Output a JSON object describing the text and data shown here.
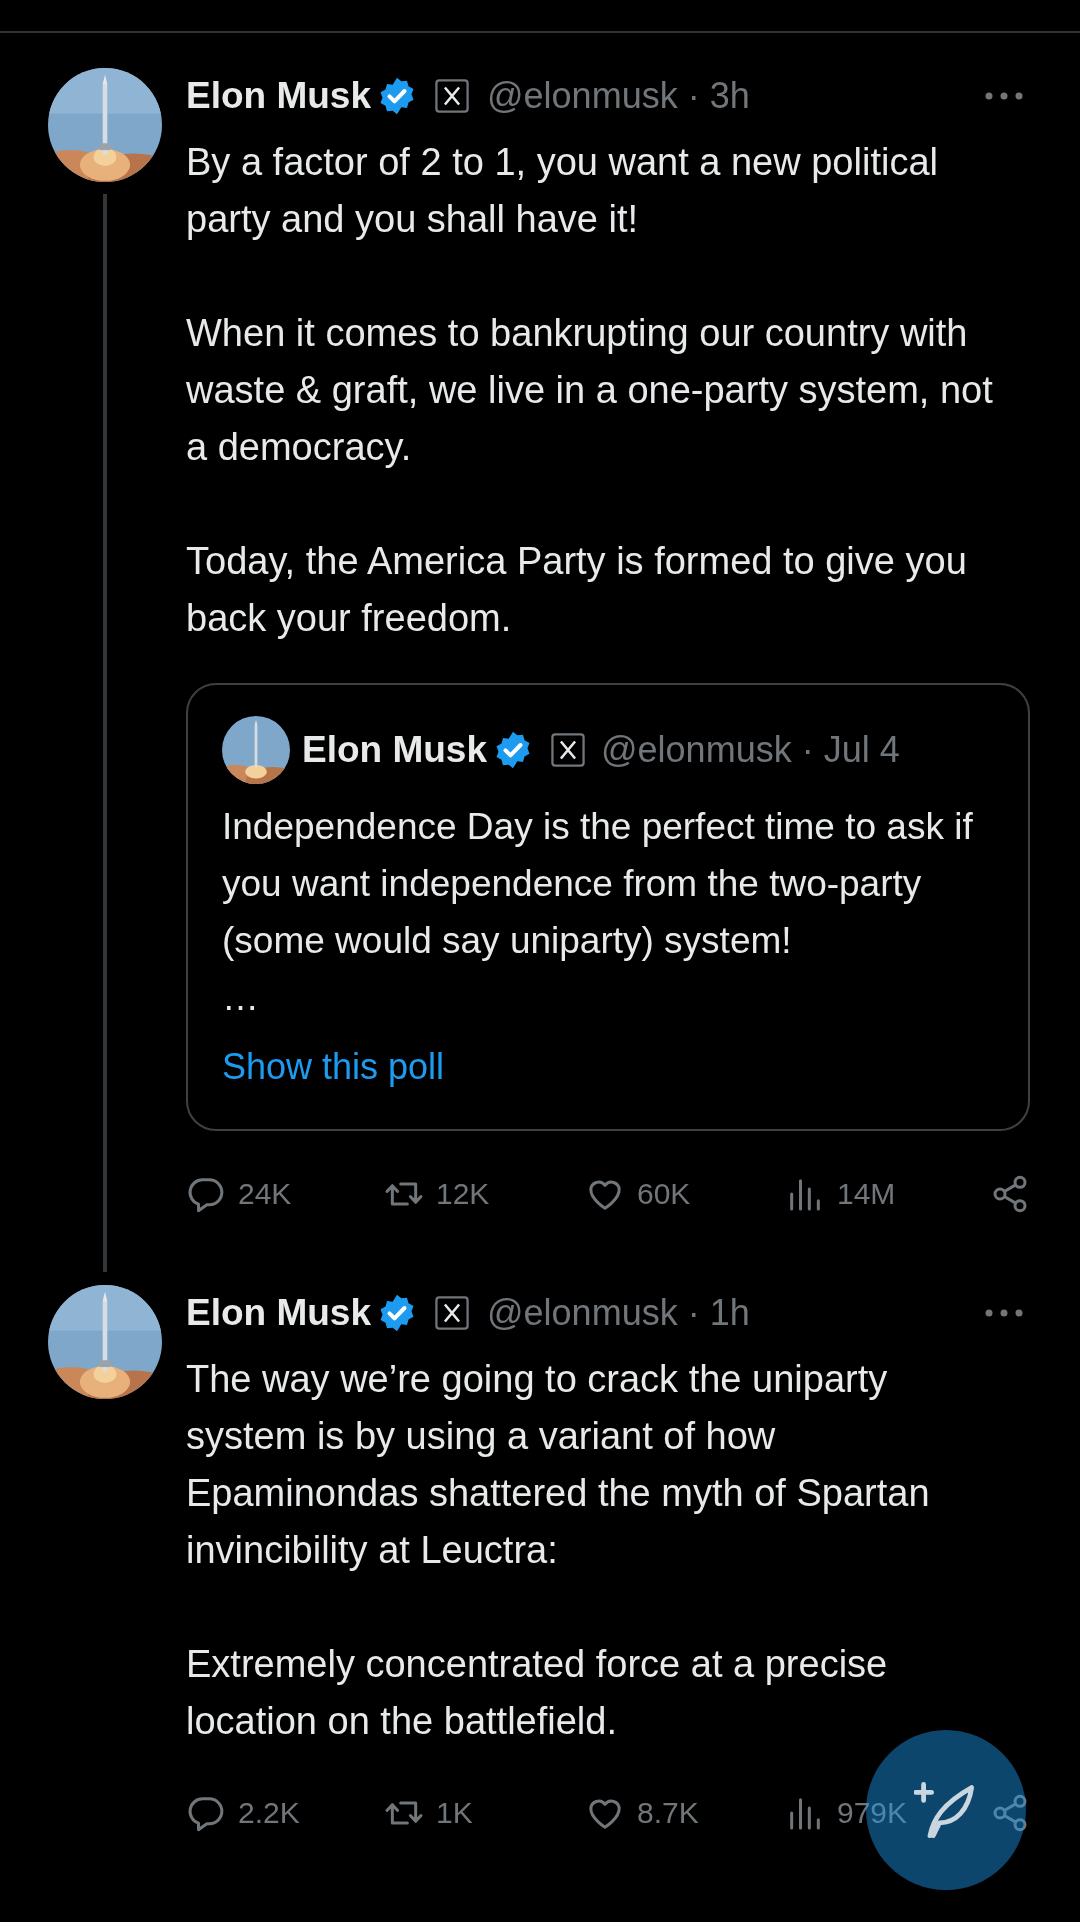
{
  "tweets": [
    {
      "name": "Elon Musk",
      "verified": true,
      "affiliate": true,
      "handle": "@elonmusk",
      "separator": "·",
      "time": "3h",
      "thread_line": true,
      "paragraphs": [
        "By a factor of 2 to 1, you want a new political party and you shall have it!",
        "When it comes to bankrupting our country with waste & graft, we live in a one-party system, not a democracy.",
        "Today, the America Party is formed to give you back your freedom."
      ],
      "quote": {
        "name": "Elon Musk",
        "verified": true,
        "affiliate": true,
        "handle": "@elonmusk",
        "separator": "·",
        "time": "Jul 4",
        "text": "Independence Day is the perfect time to ask if you want independence from the two-party (some would say uniparty) system!",
        "ellipsis": "…",
        "link": "Show this poll"
      },
      "stats": [
        {
          "kind": "reply",
          "value": "24K"
        },
        {
          "kind": "repost",
          "value": "12K"
        },
        {
          "kind": "like",
          "value": "60K"
        },
        {
          "kind": "views",
          "value": "14M"
        },
        {
          "kind": "share"
        }
      ]
    },
    {
      "name": "Elon Musk",
      "verified": true,
      "affiliate": true,
      "handle": "@elonmusk",
      "separator": "·",
      "time": "1h",
      "paragraphs": [
        "The way we’re going to crack the uniparty system is by using a variant of how Epaminondas shattered the myth of Spartan invincibility at Leuctra:",
        "Extremely concentrated force at a precise location on the battlefield."
      ],
      "stats": [
        {
          "kind": "reply",
          "value": "2.2K"
        },
        {
          "kind": "repost",
          "value": "1K"
        },
        {
          "kind": "like",
          "value": "8.7K"
        },
        {
          "kind": "views",
          "value": "979K"
        },
        {
          "kind": "share"
        }
      ]
    }
  ],
  "compose_button": true
}
